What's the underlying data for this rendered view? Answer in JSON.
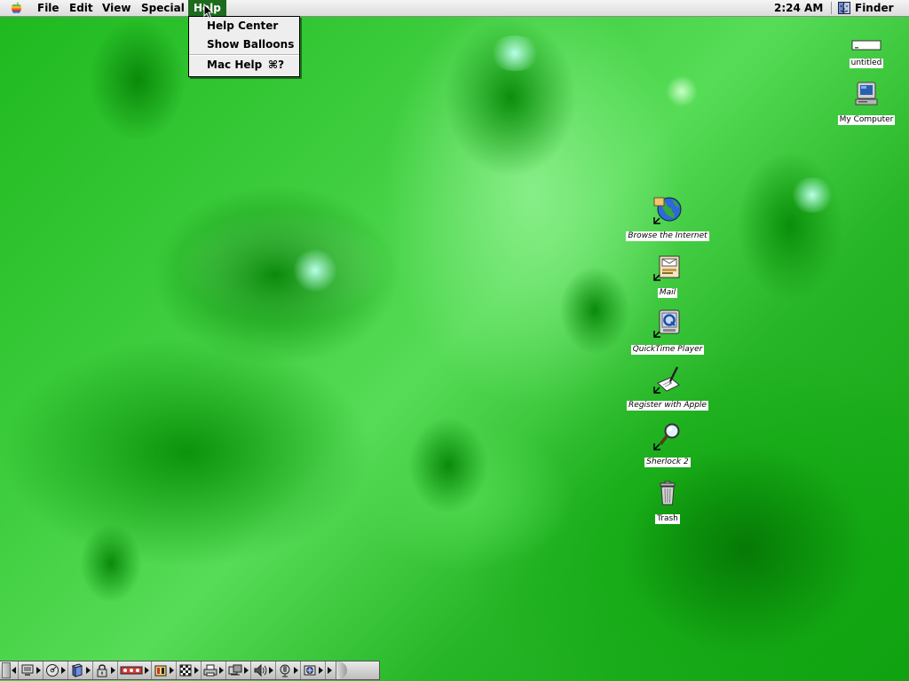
{
  "menubar": {
    "apple_icon": "apple-logo-icon",
    "menus": [
      {
        "label": "File"
      },
      {
        "label": "Edit"
      },
      {
        "label": "View"
      },
      {
        "label": "Special"
      },
      {
        "label": "Help",
        "active": true
      }
    ],
    "clock": "2:24 AM",
    "app_menu": {
      "label": "Finder",
      "icon": "finder-icon"
    }
  },
  "help_menu": {
    "items": [
      {
        "label": "Help Center"
      },
      {
        "label": "Show Balloons"
      },
      {
        "label": "Mac Help",
        "shortcut": "⌘?"
      }
    ]
  },
  "desktop": {
    "icons": [
      {
        "label": "untitled",
        "icon": "disk-icon",
        "alias": false
      },
      {
        "label": "My Computer",
        "icon": "computer-icon",
        "alias": false
      },
      {
        "label": "Browse the Internet",
        "icon": "globe-icon",
        "alias": true
      },
      {
        "label": "Mail",
        "icon": "mail-icon",
        "alias": true
      },
      {
        "label": "QuickTime Player",
        "icon": "quicktime-icon",
        "alias": true
      },
      {
        "label": "Register with Apple",
        "icon": "register-icon",
        "alias": true
      },
      {
        "label": "Sherlock 2",
        "icon": "sherlock-icon",
        "alias": true
      },
      {
        "label": "Trash",
        "icon": "trash-icon",
        "alias": false
      }
    ]
  },
  "control_strip": {
    "modules": [
      "monitor-icon",
      "cd-icon",
      "file-sharing-icon",
      "keychain-icon",
      "appletalk-icon",
      "battery-icon",
      "desktop-pattern-icon",
      "printer-icon",
      "remote-access-icon",
      "sound-volume-icon",
      "speech-icon",
      "web-sharing-icon"
    ]
  },
  "colors": {
    "desktop_green": "#2cc22c",
    "menu_highlight": "#1e6b1e"
  }
}
